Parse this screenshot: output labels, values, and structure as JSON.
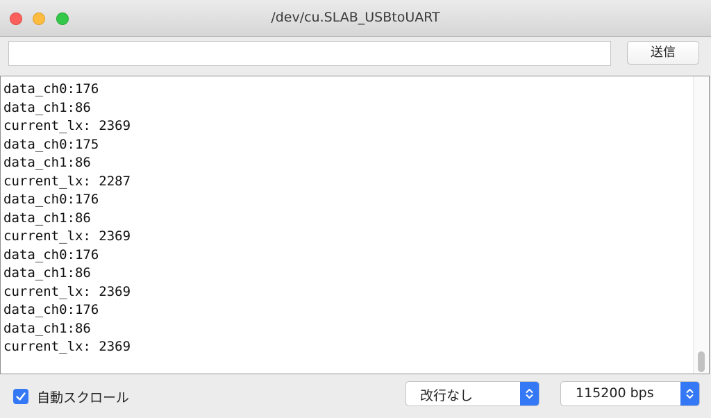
{
  "window": {
    "title": "/dev/cu.SLAB_USBtoUART"
  },
  "send": {
    "input_value": "",
    "button_label": "送信"
  },
  "output": {
    "lines": [
      "data_ch0:176",
      "data_ch1:86",
      "current_lx: 2369",
      "data_ch0:175",
      "data_ch1:86",
      "current_lx: 2287",
      "data_ch0:176",
      "data_ch1:86",
      "current_lx: 2369",
      "data_ch0:176",
      "data_ch1:86",
      "current_lx: 2369",
      "data_ch0:176",
      "data_ch1:86",
      "current_lx: 2369"
    ]
  },
  "footer": {
    "autoscroll_label": "自動スクロール",
    "autoscroll_checked": true,
    "line_ending_value": "改行なし",
    "baud_rate_value": "115200 bps"
  },
  "colors": {
    "accent": "#3478f6",
    "close": "#fc605c",
    "minimize": "#fdbc40",
    "maximize": "#34c84a"
  },
  "icons": {
    "close": "close-icon",
    "minimize": "minimize-icon",
    "maximize": "maximize-icon",
    "checkmark": "checkmark-icon",
    "updown": "chevron-updown-icon"
  }
}
